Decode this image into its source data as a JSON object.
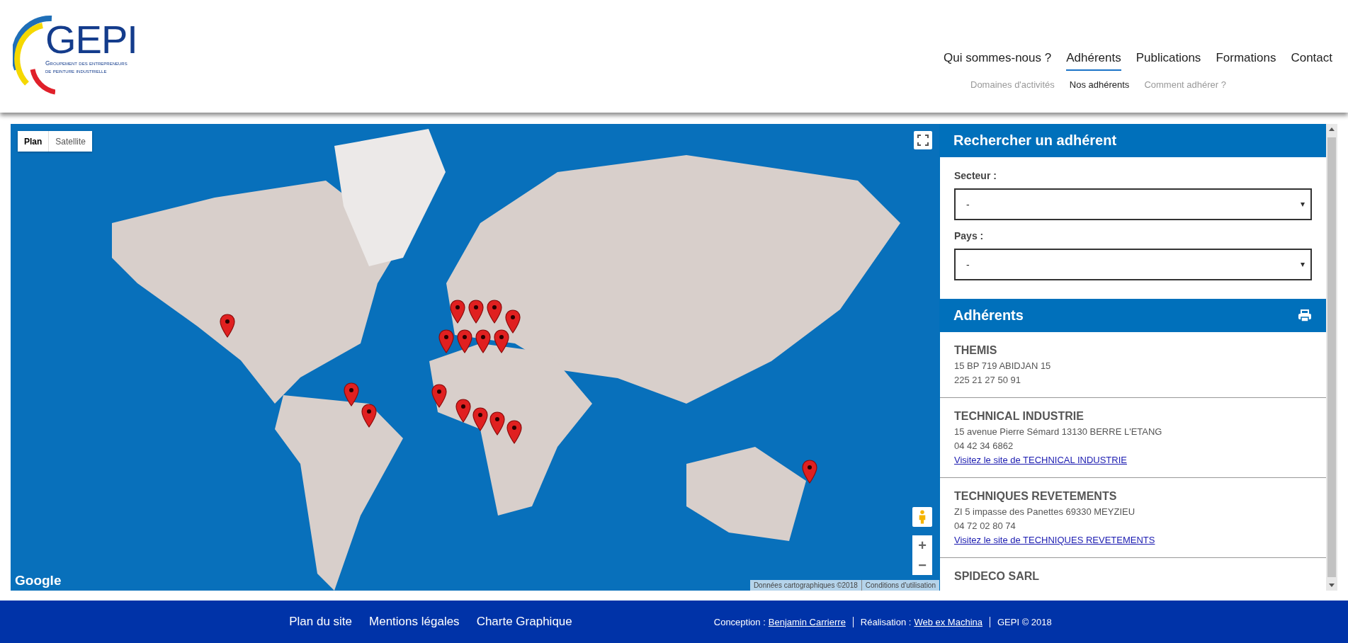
{
  "logo": {
    "mark": "GEPI",
    "line_1": "Groupement des entrepreneurs",
    "line_2": "de peinture industrielle"
  },
  "nav": [
    {
      "label": "Qui sommes-nous ?",
      "selected": false
    },
    {
      "label": "Adhérents",
      "selected": true
    },
    {
      "label": "Publications",
      "selected": false
    },
    {
      "label": "Formations",
      "selected": false
    },
    {
      "label": "Contact",
      "selected": false
    }
  ],
  "subnav": [
    {
      "label": "Domaines d'activités",
      "selected": false
    },
    {
      "label": "Nos adhérents",
      "selected": true
    },
    {
      "label": "Comment adhérer ?",
      "selected": false
    }
  ],
  "map": {
    "map_types": [
      {
        "label": "Plan",
        "selected": true
      },
      {
        "label": "Satellite",
        "selected": false
      }
    ],
    "zoom_in": "+",
    "zoom_out": "−",
    "brand": "Google",
    "attribution": "Données cartographiques ©2018",
    "terms": "Conditions d'utilisation"
  },
  "search": {
    "title": "Rechercher un adhérent",
    "fields": [
      {
        "label": "Secteur :",
        "value": "-"
      },
      {
        "label": "Pays :",
        "value": "-"
      }
    ]
  },
  "members": {
    "title": "Adhérents",
    "items": [
      {
        "name": "THEMIS",
        "lines": [
          "15 BP 719 ABIDJAN 15",
          "225 21 27 50 91"
        ]
      },
      {
        "name": "TECHNICAL INDUSTRIE",
        "lines": [
          "15 avenue Pierre Sémard 13130 BERRE L'ETANG",
          "04 42 34 6862"
        ],
        "link": "Visitez le site de TECHNICAL INDUSTRIE"
      },
      {
        "name": "TECHNIQUES REVETEMENTS",
        "lines": [
          "ZI 5 impasse des Panettes 69330 MEYZIEU",
          "04 72 02 80 74"
        ],
        "link": "Visitez le site de TECHNIQUES REVETEMENTS"
      },
      {
        "name": "SPIDECO SARL"
      }
    ]
  },
  "footer": {
    "links": [
      "Plan du site",
      "Mentions légales",
      "Charte Graphique"
    ],
    "credits": [
      {
        "label": "Conception :",
        "link": "Benjamin Carrierre"
      },
      {
        "label": "Réalisation :",
        "link": "Web ex Machina"
      },
      {
        "label": "GEPI © 2018"
      }
    ]
  }
}
